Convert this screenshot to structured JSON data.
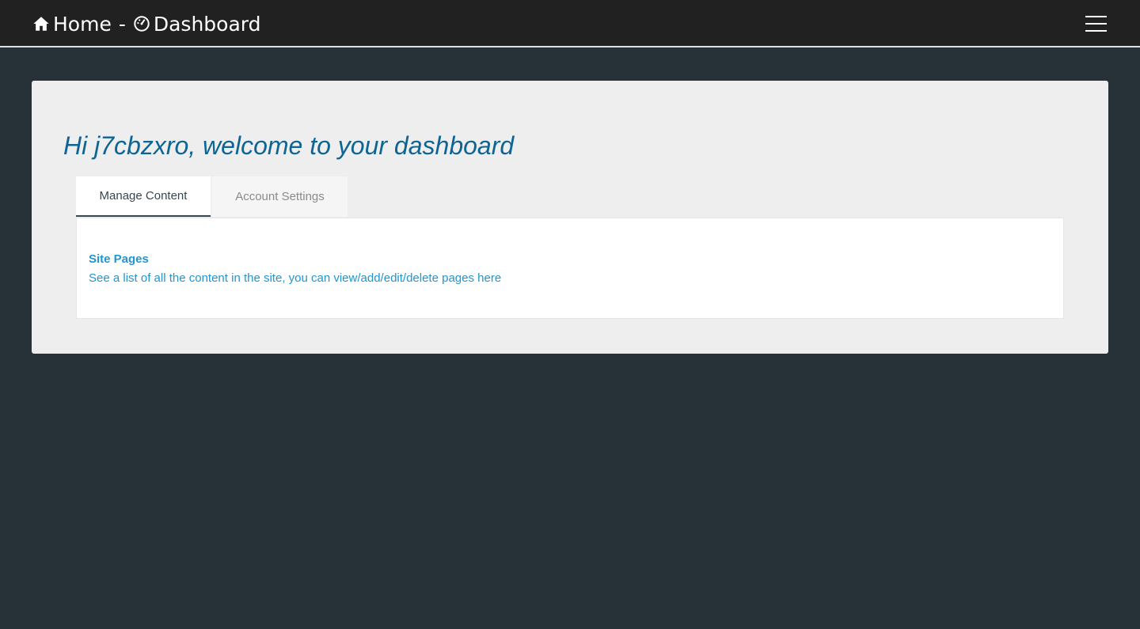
{
  "navbar": {
    "home_label": "Home",
    "separator": "-",
    "dashboard_label": "Dashboard",
    "home_icon": "home-icon",
    "dashboard_icon": "dashboard-gauge-icon",
    "menu_icon": "hamburger-menu-icon"
  },
  "dashboard": {
    "welcome": "Hi j7cbzxro, welcome to your dashboard",
    "tabs": [
      {
        "label": "Manage Content",
        "active": true
      },
      {
        "label": "Account Settings",
        "active": false
      }
    ],
    "content": {
      "title": "Site Pages",
      "description": "See a list of all the content in the site, you can view/add/edit/delete pages here"
    }
  },
  "colors": {
    "background": "#263238",
    "navbar": "#212121",
    "panel": "#eeeeee",
    "welcome_text": "#0e6492",
    "link": "#2196d3"
  }
}
